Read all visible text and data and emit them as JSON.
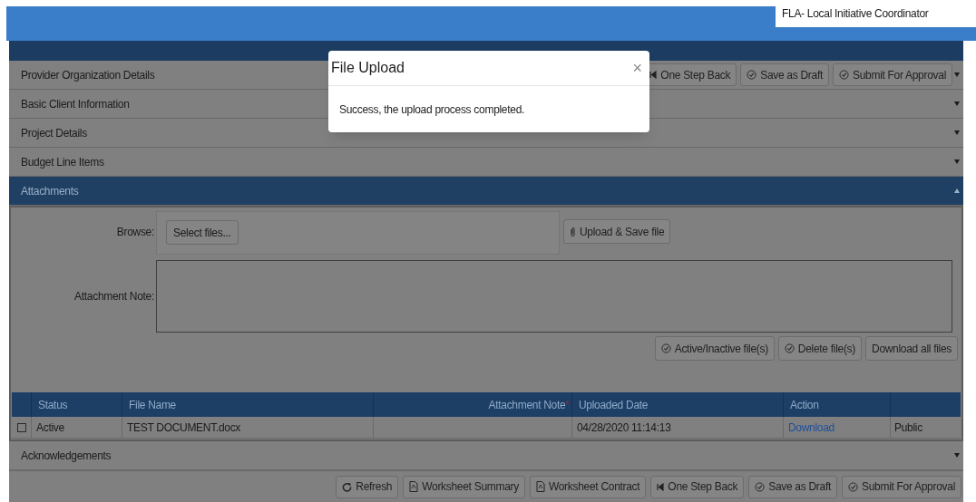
{
  "top_bar": {
    "role": "FLA- Local Initiative Coordinator"
  },
  "header_actions": [
    {
      "kind": "back",
      "label": "One Step Back"
    },
    {
      "kind": "check",
      "label": "Save as Draft"
    },
    {
      "kind": "check",
      "label": "Submit For Approval"
    }
  ],
  "sections": [
    {
      "label": "Provider Organization Details",
      "expanded": false
    },
    {
      "label": "Basic Client Information",
      "expanded": false
    },
    {
      "label": "Project Details",
      "expanded": false
    },
    {
      "label": "Budget Line Items",
      "expanded": false
    },
    {
      "label": "Attachments",
      "expanded": true
    },
    {
      "label": "Acknowledgements",
      "expanded": false
    }
  ],
  "attachments": {
    "browse_label": "Browse:",
    "select_button": "Select files...",
    "upload_button": "Upload & Save file",
    "note_label": "Attachment Note:",
    "actions": [
      {
        "kind": "check",
        "label": "Active/Inactive file(s)"
      },
      {
        "kind": "check",
        "label": "Delete file(s)"
      },
      {
        "kind": "plain",
        "label": "Download all files"
      }
    ],
    "table": {
      "columns": [
        {
          "label": "Status"
        },
        {
          "label": "File Name"
        },
        {
          "label": "Attachment Note",
          "required_mark": "*"
        },
        {
          "label": "Uploaded Date"
        },
        {
          "label": "Action"
        }
      ],
      "rows": [
        {
          "checked": false,
          "status": "Active",
          "file_name": "TEST DOCUMENT.docx",
          "uploaded_date": "04/28/2020 11:14:13",
          "action": "Download",
          "visibility": "Public"
        }
      ]
    }
  },
  "footer_actions": [
    {
      "kind": "refresh",
      "label": "Refresh"
    },
    {
      "kind": "document",
      "label": "Worksheet Summary"
    },
    {
      "kind": "document",
      "label": "Worksheet Contract"
    },
    {
      "kind": "back",
      "label": "One Step Back"
    },
    {
      "kind": "check",
      "label": "Save as Draft"
    },
    {
      "kind": "check",
      "label": "Submit For Approval"
    }
  ],
  "modal": {
    "title": "File Upload",
    "close": "×",
    "message": "Success, the upload process completed."
  }
}
